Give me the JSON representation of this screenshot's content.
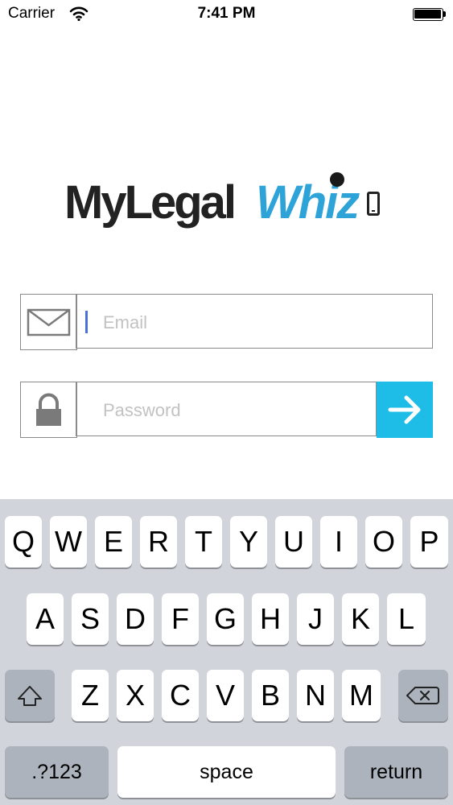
{
  "status_bar": {
    "carrier": "Carrier",
    "time": "7:41 PM"
  },
  "logo": {
    "part1": "MyLegal",
    "part2": "Whiz"
  },
  "login": {
    "email_placeholder": "Email",
    "password_placeholder": "Password"
  },
  "icons": {
    "email": "envelope-icon",
    "password": "lock-icon",
    "submit": "arrow-right-icon",
    "shift": "shift-icon",
    "backspace": "backspace-icon"
  },
  "colors": {
    "accent": "#1dbde8",
    "logo_blue": "#2ea3d8",
    "caret": "#4a6fd8"
  },
  "keyboard": {
    "row1": [
      "Q",
      "W",
      "E",
      "R",
      "T",
      "Y",
      "U",
      "I",
      "O",
      "P"
    ],
    "row2": [
      "A",
      "S",
      "D",
      "F",
      "G",
      "H",
      "J",
      "K",
      "L"
    ],
    "row3": [
      "Z",
      "X",
      "C",
      "V",
      "B",
      "N",
      "M"
    ],
    "numbers_label": ".?123",
    "space_label": "space",
    "return_label": "return"
  }
}
